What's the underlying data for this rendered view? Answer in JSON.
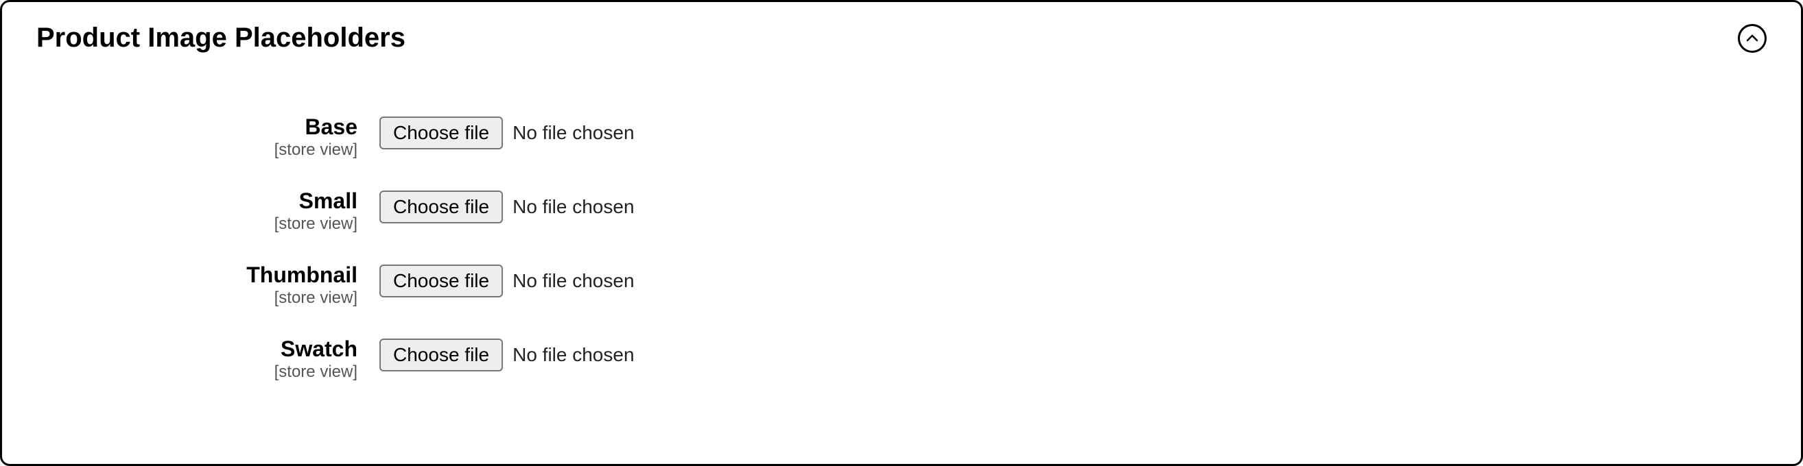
{
  "section": {
    "title": "Product Image Placeholders"
  },
  "fields": {
    "base": {
      "label": "Base",
      "scope": "[store view]",
      "button": "Choose file",
      "status": "No file chosen"
    },
    "small": {
      "label": "Small",
      "scope": "[store view]",
      "button": "Choose file",
      "status": "No file chosen"
    },
    "thumbnail": {
      "label": "Thumbnail",
      "scope": "[store view]",
      "button": "Choose file",
      "status": "No file chosen"
    },
    "swatch": {
      "label": "Swatch",
      "scope": "[store view]",
      "button": "Choose file",
      "status": "No file chosen"
    }
  }
}
